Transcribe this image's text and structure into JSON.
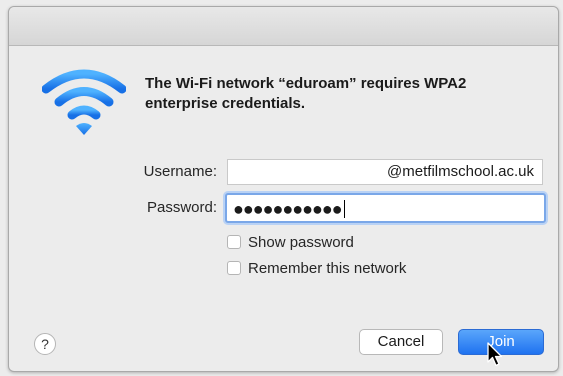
{
  "dialog": {
    "message": "The Wi-Fi network “eduroam” requires WPA2 enterprise credentials.",
    "icon": "wifi-icon",
    "accent_color": "#1f8cf2"
  },
  "form": {
    "username_label": "Username:",
    "username_value": "@metfilmschool.ac.uk",
    "password_label": "Password:",
    "password_value": "●●●●●●●●●●●",
    "show_password_label": "Show password",
    "remember_network_label": "Remember this network"
  },
  "buttons": {
    "help_label": "?",
    "cancel_label": "Cancel",
    "join_label": "Join"
  }
}
